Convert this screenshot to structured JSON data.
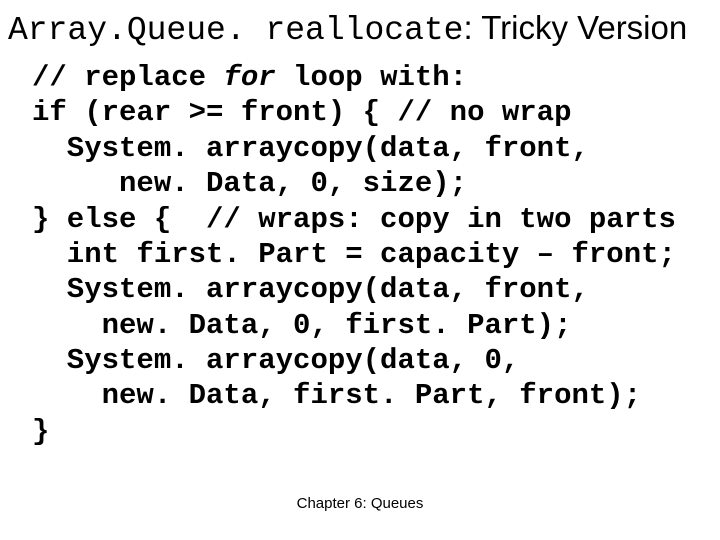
{
  "title": {
    "mono": "Array.Queue. reallocate",
    "sans": ": Tricky Version"
  },
  "code": {
    "l1a": "// replace ",
    "l1b": "for",
    "l1c": " loop with:",
    "l2": "if (rear >= front) { // no wrap",
    "l3": "  System. arraycopy(data, front,",
    "l4": "     new. Data, 0, size);",
    "l5": "} else {  // wraps: copy in two parts",
    "l6": "  int first. Part = capacity – front;",
    "l7": "  System. arraycopy(data, front,",
    "l8": "    new. Data, 0, first. Part);",
    "l9": "  System. arraycopy(data, 0,",
    "l10": "    new. Data, first. Part, front);",
    "l11": "}"
  },
  "footer": "Chapter 6: Queues"
}
